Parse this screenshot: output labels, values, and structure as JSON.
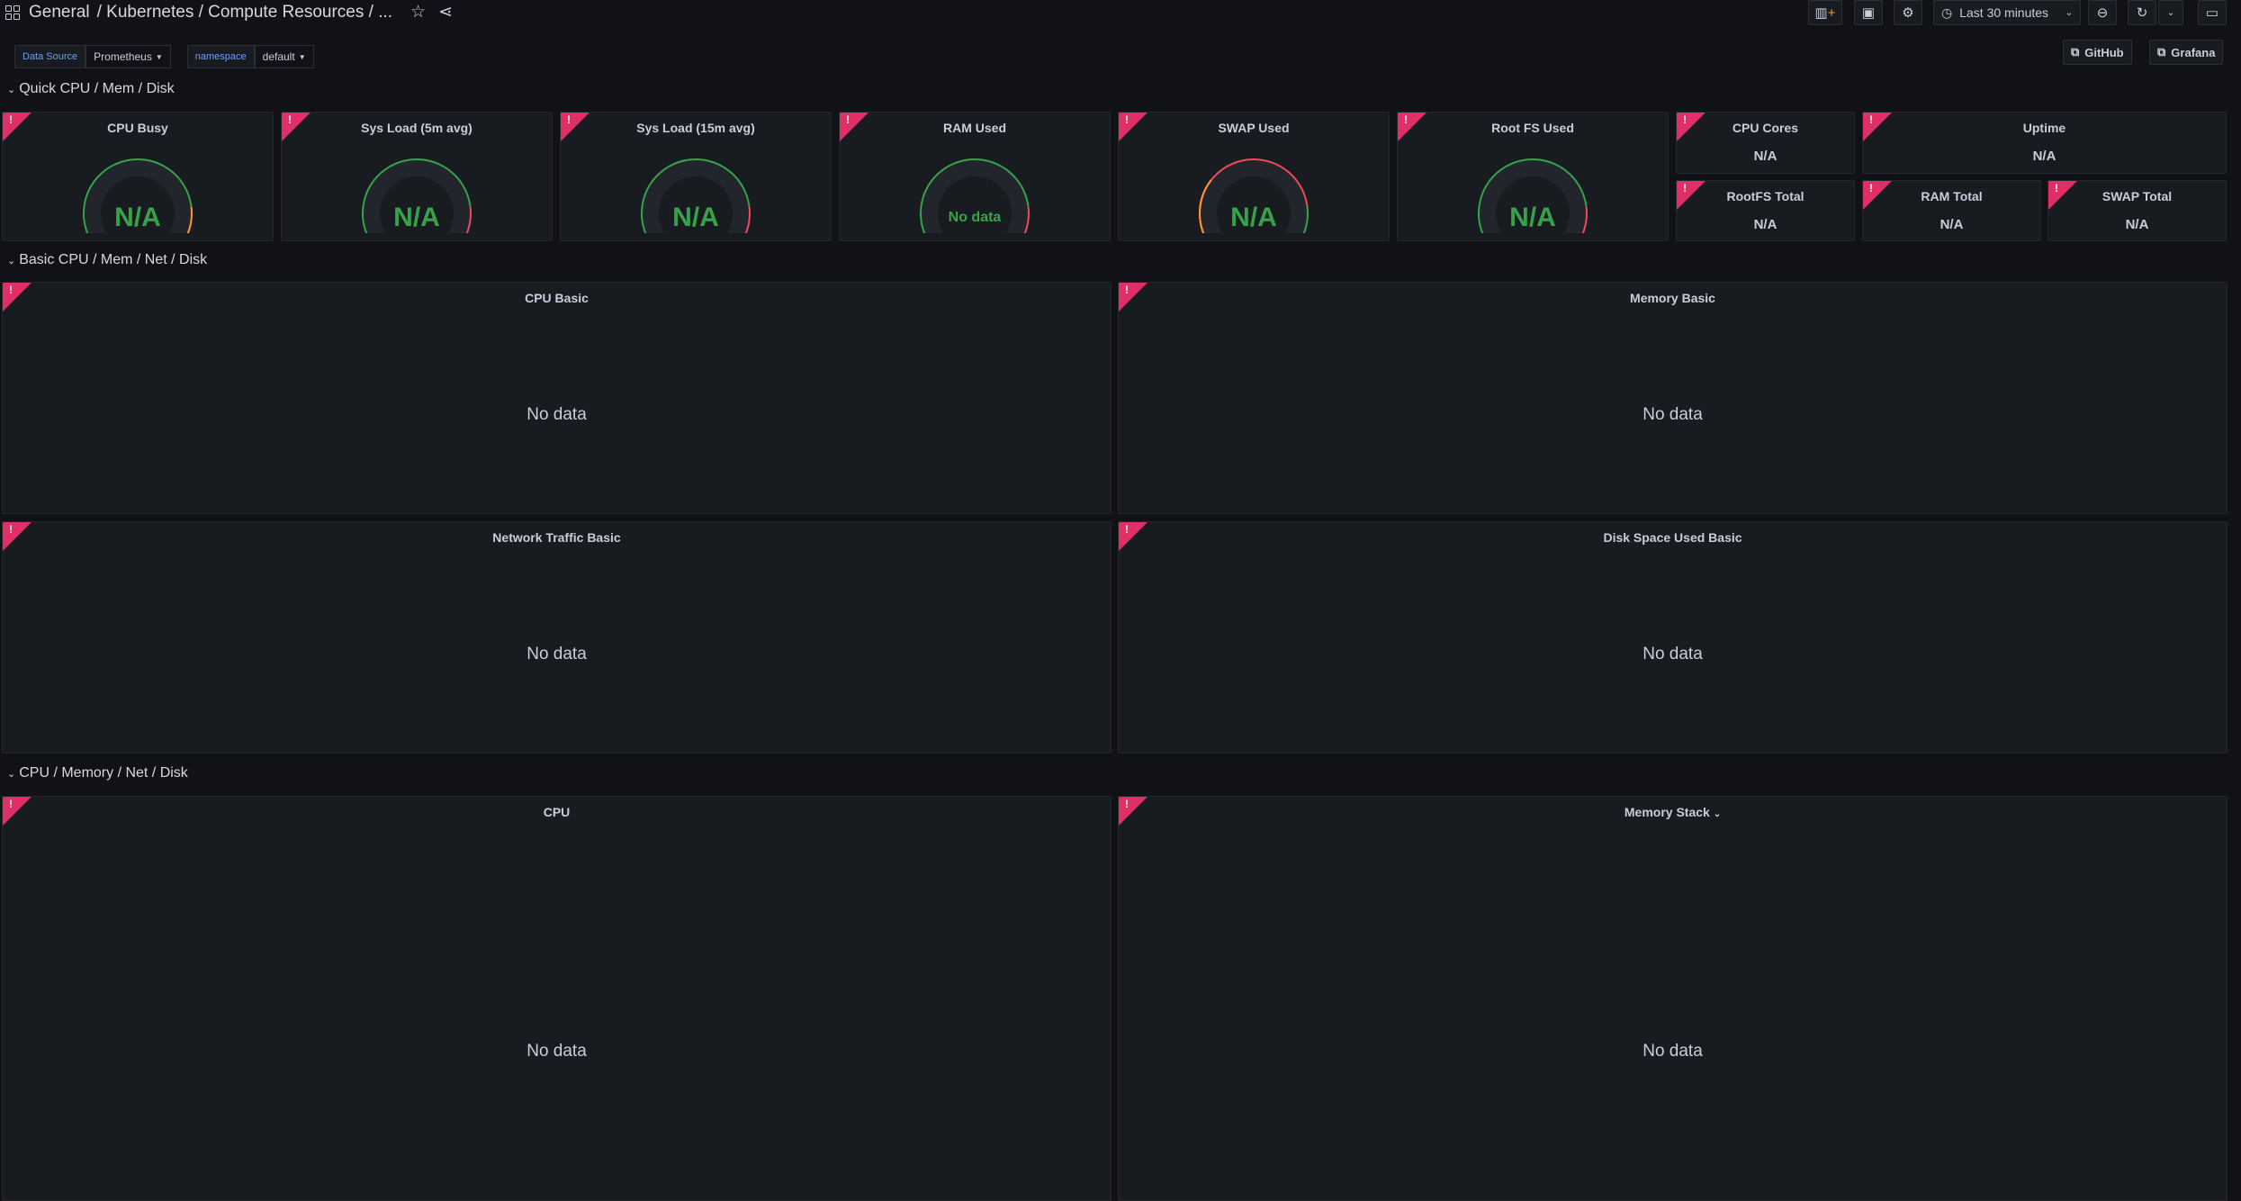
{
  "breadcrumb": {
    "root": "General",
    "path": "/ Kubernetes / Compute Resources / ..."
  },
  "toolbar": {
    "time_range": "Last 30 minutes"
  },
  "variables": [
    {
      "label": "Data Source",
      "value": "Prometheus"
    },
    {
      "label": "namespace",
      "value": "default"
    }
  ],
  "links": [
    {
      "label": "GitHub"
    },
    {
      "label": "Grafana"
    }
  ],
  "rows": [
    {
      "title": "Quick CPU / Mem / Disk"
    },
    {
      "title": "Basic CPU / Mem / Net / Disk"
    },
    {
      "title": "CPU / Memory / Net / Disk"
    }
  ],
  "gauges": [
    {
      "title": "CPU Busy",
      "value": "N/A"
    },
    {
      "title": "Sys Load (5m avg)",
      "value": "N/A"
    },
    {
      "title": "Sys Load (15m avg)",
      "value": "N/A"
    },
    {
      "title": "RAM Used",
      "value": "No data"
    },
    {
      "title": "SWAP Used",
      "value": "N/A"
    },
    {
      "title": "Root FS Used",
      "value": "N/A"
    }
  ],
  "stats": [
    {
      "title": "CPU Cores",
      "value": "N/A"
    },
    {
      "title": "Uptime",
      "value": "N/A"
    },
    {
      "title": "RootFS Total",
      "value": "N/A"
    },
    {
      "title": "RAM Total",
      "value": "N/A"
    },
    {
      "title": "SWAP Total",
      "value": "N/A"
    }
  ],
  "graphs": [
    {
      "title": "CPU Basic",
      "message": "No data"
    },
    {
      "title": "Memory Basic",
      "message": "No data"
    },
    {
      "title": "Network Traffic Basic",
      "message": "No data"
    },
    {
      "title": "Disk Space Used Basic",
      "message": "No data"
    },
    {
      "title": "CPU",
      "message": "No data"
    },
    {
      "title": "Memory Stack",
      "message": "No data",
      "has_menu": true
    }
  ],
  "colors": {
    "ok": "#37a24a",
    "warn": "#ff9830",
    "crit": "#f2495c",
    "error_corner": "#e02f67",
    "bg": "#111217",
    "panel": "#181b1f"
  }
}
